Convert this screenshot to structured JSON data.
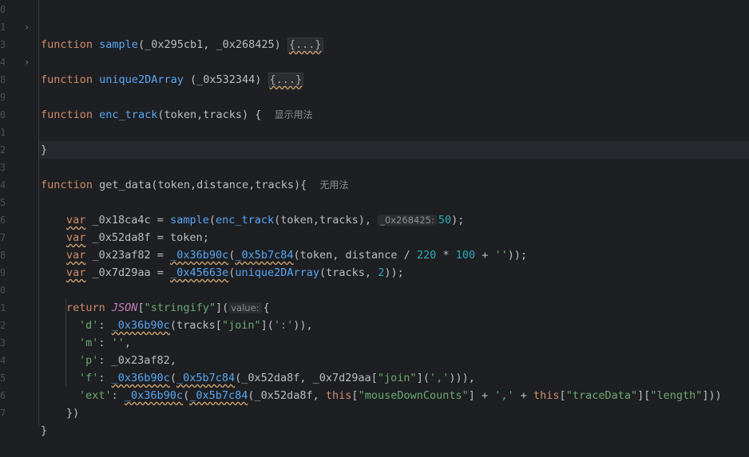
{
  "line_numbers": [
    "0",
    "1",
    "3",
    "4",
    "8",
    "9",
    "0",
    "1",
    "2",
    "3",
    "4",
    "5",
    "6",
    "7",
    "8",
    "9",
    "0",
    "1",
    "2",
    "3",
    "4",
    "5",
    "6",
    "7"
  ],
  "code": {
    "l1": {
      "kw": "function",
      "name": "sample",
      "args": "(_0x295cb1, _0x268425)",
      "fold": "{...}"
    },
    "l2": {
      "kw": "function",
      "name": "unique2DArray",
      "args": " (_0x532344)",
      "fold": "{...}"
    },
    "l3": {
      "kw": "function",
      "name": "enc_track",
      "args": "(token,tracks) {",
      "hint": "显示用法"
    },
    "l4": {
      "close": "}"
    },
    "l5": {
      "kw": "function",
      "name": "get_data",
      "args": "(token,distance,tracks){",
      "hint": "无用法"
    },
    "l6": {
      "var": "var",
      "ident": " _0x18ca4c = ",
      "call1": "sample",
      "p1": "(",
      "call2": "enc_track",
      "p2": "(token,tracks), ",
      "hint": "_0x268425:",
      "num": "50",
      "end": ");"
    },
    "l7": {
      "var": "var",
      "rest": " _0x52da8f = token;"
    },
    "l8": {
      "var": "var",
      "ident": " _0x23af82 = ",
      "c1": "_0x36b90c",
      "p1": "(",
      "c2": "_0x5b7c84",
      "p2": "(token, distance / ",
      "n1": "220",
      "op": " * ",
      "n2": "100",
      "op2": " + ",
      "s": "''",
      "end": "));"
    },
    "l9": {
      "var": "var",
      "ident": " _0x7d29aa = ",
      "c1": "_0x45663e",
      "p1": "(",
      "c2": "unique2DArray",
      "p2": "(tracks, ",
      "n": "2",
      "end": "));"
    },
    "l10": {
      "kw": "return",
      "obj": "JSON",
      "b1": "[",
      "s": "\"stringify\"",
      "b2": "](",
      "hint": "value:",
      "end": "{"
    },
    "l11": {
      "key": "'d'",
      "c": ": ",
      "f": "_0x36b90c",
      "a": "(tracks[",
      "s": "\"join\"",
      "b": "](",
      "s2": "':'",
      "end": ")),"
    },
    "l12": {
      "key": "'m'",
      "c": ": ",
      "s": "''",
      "end": ","
    },
    "l13": {
      "key": "'p'",
      "c": ": ",
      "rest": "_0x23af82,"
    },
    "l14": {
      "key": "'f'",
      "c": ": ",
      "f1": "_0x36b90c",
      "p1": "(",
      "f2": "_0x5b7c84",
      "p2": "(_0x52da8f, _0x7d29aa[",
      "s": "\"join\"",
      "b": "](",
      "s2": "','",
      "end": "))),"
    },
    "l15": {
      "key": "'ext'",
      "c": ": ",
      "f1": "_0x36b90c",
      "p1": "(",
      "f2": "_0x5b7c84",
      "p2": "(_0x52da8f, ",
      "this1": "this",
      "b1": "[",
      "s1": "\"mouseDownCounts\"",
      "b2": "] + ",
      "s2": "','",
      "plus": " + ",
      "this2": "this",
      "b3": "[",
      "s3": "\"traceData\"",
      "b4": "][",
      "s4": "\"length\"",
      "end": "]))"
    },
    "l16": {
      "close": "})"
    },
    "l17": {
      "close": "}"
    }
  }
}
